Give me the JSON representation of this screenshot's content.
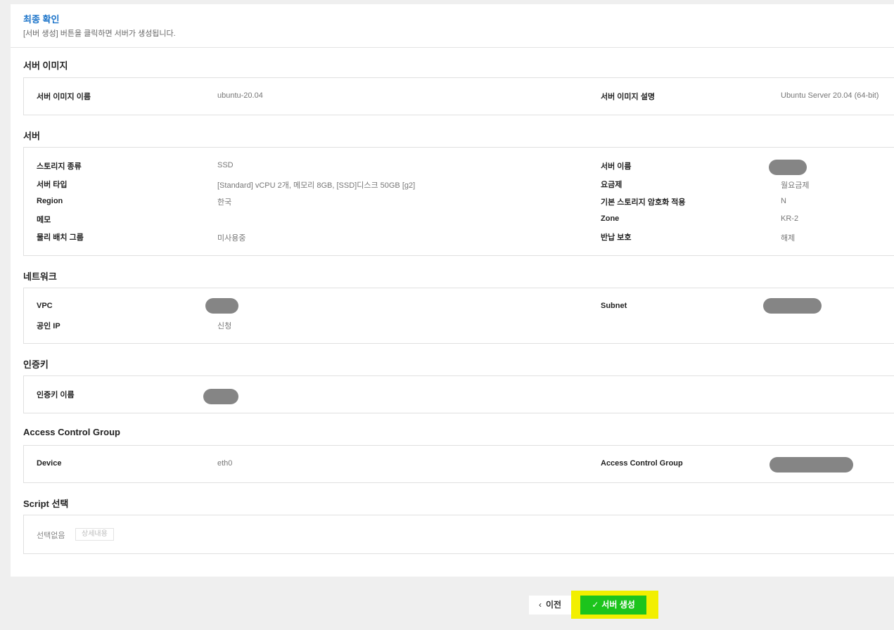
{
  "header": {
    "title": "최종 확인",
    "description": "[서버 생성] 버튼을 클릭하면 서버가 생성됩니다."
  },
  "server_image": {
    "title": "서버 이미지",
    "name_label": "서버 이미지 이름",
    "name_value": "ubuntu-20.04",
    "desc_label": "서버 이미지 설명",
    "desc_value": "Ubuntu Server 20.04 (64-bit)"
  },
  "server": {
    "title": "서버",
    "storage_type_label": "스토리지 종류",
    "storage_type_value": "SSD",
    "server_type_label": "서버 타입",
    "server_type_value": "[Standard] vCPU 2개, 메모리 8GB, [SSD]디스크 50GB [g2]",
    "region_label": "Region",
    "region_value": "한국",
    "memo_label": "메모",
    "memo_value": "",
    "placement_group_label": "물리 배치 그룹",
    "placement_group_value": "미사용중",
    "server_name_label": "서버 이름",
    "billing_label": "요금제",
    "billing_value": "월요금제",
    "encryption_label": "기본 스토리지 암호화 적용",
    "encryption_value": "N",
    "zone_label": "Zone",
    "zone_value": "KR-2",
    "return_protection_label": "반납 보호",
    "return_protection_value": "해제"
  },
  "network": {
    "title": "네트워크",
    "vpc_label": "VPC",
    "public_ip_label": "공인 IP",
    "public_ip_value": "신청",
    "subnet_label": "Subnet"
  },
  "auth_key": {
    "title": "인증키",
    "name_label": "인증키 이름"
  },
  "acg": {
    "title": "Access Control Group",
    "device_label": "Device",
    "device_value": "eth0",
    "acg_label": "Access Control Group"
  },
  "script": {
    "title": "Script 선택",
    "selection_text": "선택없음",
    "detail_button": "상세내용"
  },
  "footer": {
    "prev_icon": "‹",
    "prev_label": "이전",
    "create_icon": "✓",
    "create_label": "서버 생성",
    "highlight_color": "#f2ef00",
    "create_color": "#1cc41c"
  }
}
